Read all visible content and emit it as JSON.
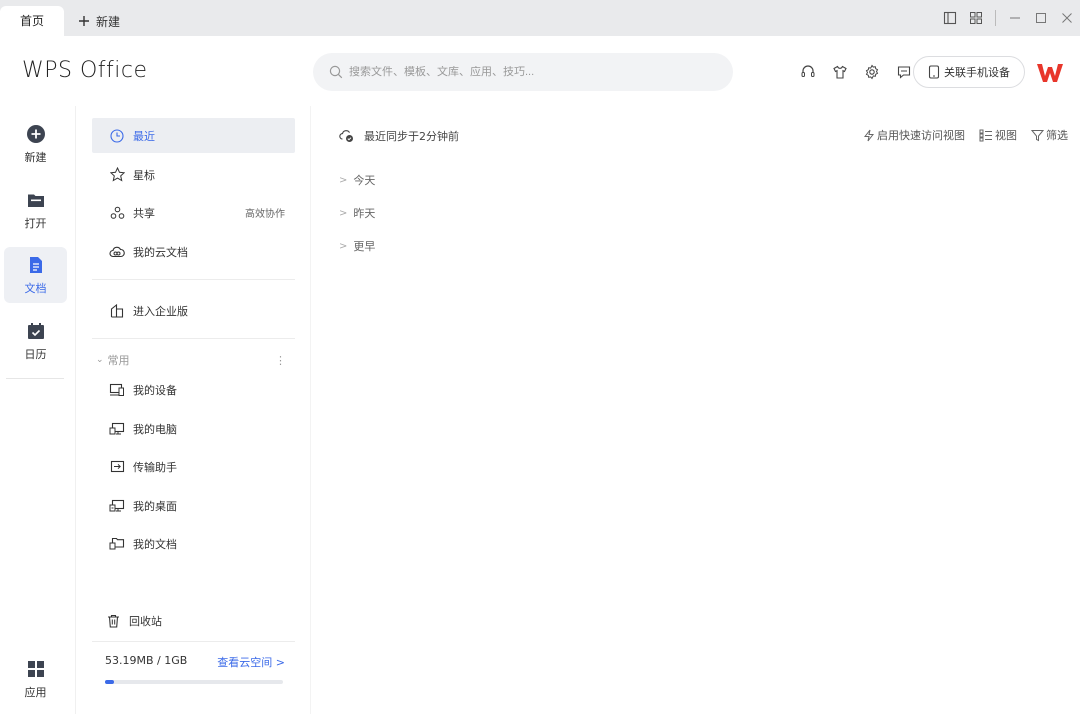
{
  "tabs": {
    "home": "首页",
    "new": "新建"
  },
  "header": {
    "logo": "WPS Office",
    "search_placeholder": "搜索文件、模板、文库、应用、技巧...",
    "phone_label": "关联手机设备"
  },
  "rail": {
    "items": [
      {
        "label": "新建",
        "icon": "plus-circle-icon"
      },
      {
        "label": "打开",
        "icon": "folder-icon"
      },
      {
        "label": "文档",
        "icon": "document-icon"
      },
      {
        "label": "日历",
        "icon": "calendar-icon"
      }
    ],
    "apps": "应用"
  },
  "sidebar": {
    "items": [
      {
        "label": "最近",
        "icon": "clock-icon"
      },
      {
        "label": "星标",
        "icon": "star-icon"
      },
      {
        "label": "共享",
        "icon": "share-icon",
        "tail": "高效协作"
      },
      {
        "label": "我的云文档",
        "icon": "cloud-icon"
      },
      {
        "label": "进入企业版",
        "icon": "building-icon"
      }
    ],
    "group": "常用",
    "group_items": [
      {
        "label": "我的设备",
        "icon": "devices-icon"
      },
      {
        "label": "我的电脑",
        "icon": "computer-icon"
      },
      {
        "label": "传输助手",
        "icon": "transfer-icon"
      },
      {
        "label": "我的桌面",
        "icon": "desktop-icon"
      },
      {
        "label": "我的文档",
        "icon": "folder-doc-icon"
      }
    ],
    "recycle": "回收站",
    "storage": {
      "used": "53.19MB / 1GB",
      "link": "查看云空间 >",
      "fraction": 0.052
    }
  },
  "content": {
    "sync": "最近同步于2分钟前",
    "tools": {
      "quick": "启用快速访问视图",
      "view": "视图",
      "filter": "筛选"
    },
    "groups": [
      "今天",
      "昨天",
      "更早"
    ]
  },
  "colors": {
    "accent": "#3b6ae8",
    "wps_red": "#e8362b"
  }
}
